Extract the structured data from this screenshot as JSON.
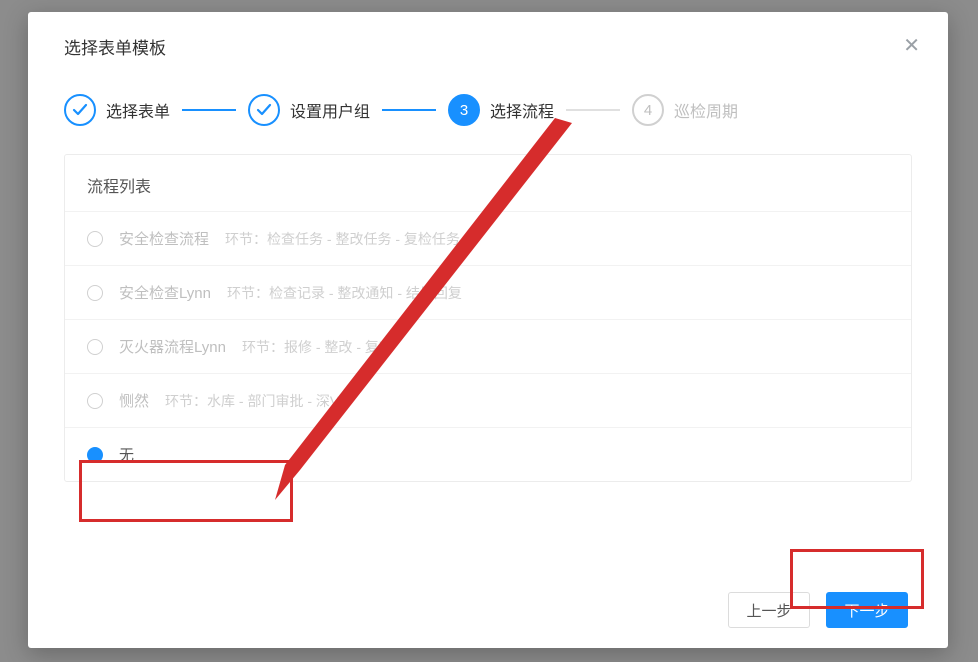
{
  "modal": {
    "title": "选择表单模板"
  },
  "steps": {
    "s1": {
      "label": "选择表单"
    },
    "s2": {
      "label": "设置用户组"
    },
    "s3": {
      "num": "3",
      "label": "选择流程"
    },
    "s4": {
      "num": "4",
      "label": "巡检周期"
    }
  },
  "list": {
    "header": "流程列表",
    "items": [
      {
        "name": "安全检查流程",
        "desc": "环节：检查任务 - 整改任务 - 复检任务"
      },
      {
        "name": "安全检查Lynn",
        "desc": "环节：检查记录 - 整改通知 - 结果回复"
      },
      {
        "name": "灭火器流程Lynn",
        "desc": "环节：报修 - 整改 - 复查"
      },
      {
        "name": "恻然",
        "desc": "环节：水库 - 部门审批 - 深V"
      }
    ],
    "none": {
      "name": "无"
    }
  },
  "footer": {
    "prev": "上一步",
    "next": "下一步"
  }
}
